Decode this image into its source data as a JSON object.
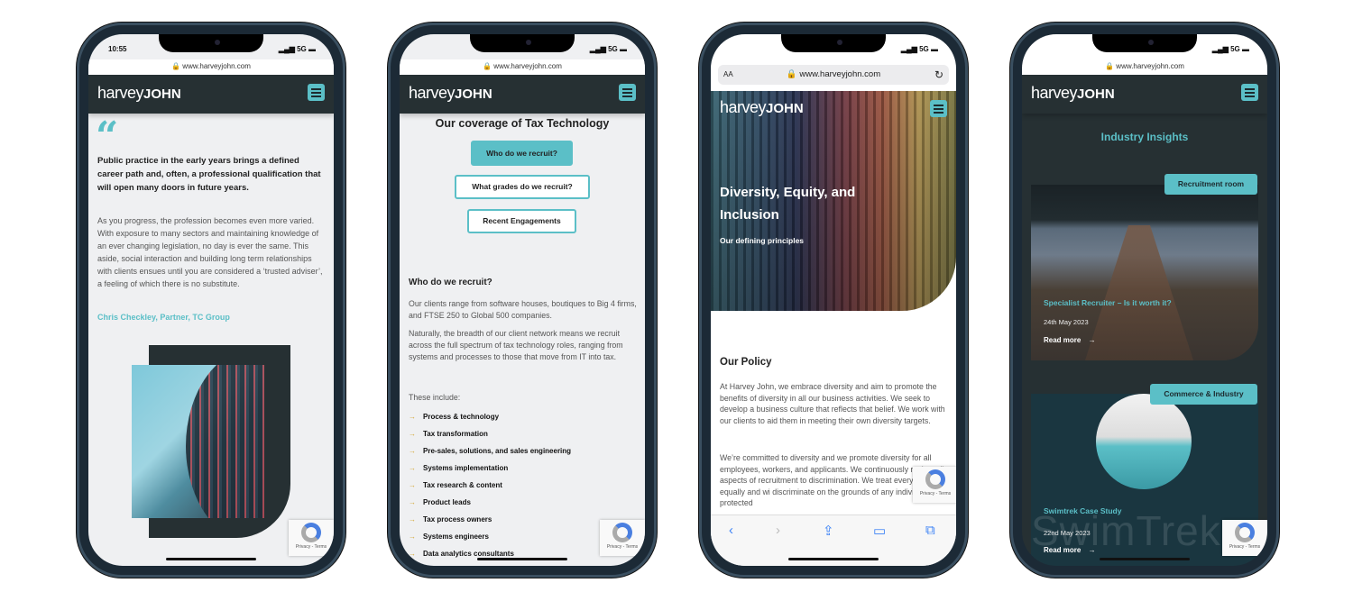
{
  "colors": {
    "accent": "#5bbfc7",
    "header": "#263033",
    "page_bg": "#eff0f2",
    "bullet": "#d4a93a"
  },
  "common": {
    "url": "www.harveyjohn.com",
    "logo_light": "harvey",
    "logo_bold": "JOHN",
    "network": "5G",
    "recaptcha": "Privacy - Terms",
    "lock_icon": "lock-icon",
    "menu_icon": "hamburger-icon"
  },
  "phone1": {
    "time": "10:55",
    "quote_mark": "“",
    "quote": "Public practice in the early years brings a defined career path and, often, a professional qualification that will open many doors in future years.",
    "body": "As you progress, the profession becomes even more varied. With exposure to many sectors and maintaining knowledge of an ever changing legislation, no day is ever the same. This aside, social interaction and building long term relationships with clients ensues until you are considered a ‘trusted adviser’, a feeling of which there is no substitute.",
    "author": "Chris Checkley, Partner, TC Group"
  },
  "phone2": {
    "title": "Our coverage of Tax Technology",
    "tabs": [
      {
        "label": "Who do we recruit?",
        "active": true
      },
      {
        "label": "What grades do we recruit?",
        "active": false
      },
      {
        "label": "Recent Engagements",
        "active": false
      }
    ],
    "section_title": "Who do we recruit?",
    "p1": "Our clients range from software houses, boutiques to Big 4 firms, and FTSE 250 to Global 500 companies.",
    "p2": "Naturally, the breadth of our client network means we recruit across the full spectrum of tax technology roles, ranging from systems and processes to those that move from IT into tax.",
    "p3": "These include:",
    "items": [
      "Process & technology",
      "Tax transformation",
      "Pre-sales, solutions, and sales engineering",
      "Systems implementation",
      "Tax research & content",
      "Product leads",
      "Tax process owners",
      "Systems engineers",
      "Data analytics consultants"
    ]
  },
  "phone3": {
    "aa": "AA",
    "hero_title": "Diversity, Equity, and Inclusion",
    "hero_subtitle": "Our defining principles",
    "policy_title": "Our Policy",
    "p1": "At Harvey John, we embrace diversity and aim to promote the benefits of diversity in all our business activities. We seek to develop a business culture that reflects that belief. We work with our clients to aid them in meeting their own diversity targets.",
    "p2": "We’re committed to diversity and we promote diversity for all employees, workers, and applicants. We continuously review all aspects of recruitment to discrimination. We treat everyone equally and wi discriminate on the grounds of any individual’s protected"
  },
  "phone4": {
    "title": "Industry Insights",
    "cards": [
      {
        "tag": "Recruitment room",
        "title": "Specialist Recruiter – Is it worth it?",
        "date": "24th May 2023",
        "link": "Read more"
      },
      {
        "tag": "Commerce & Industry",
        "title": "Swimtrek Case Study",
        "date": "22nd May 2023",
        "link": "Read more",
        "watermark": "SwimTrek"
      }
    ]
  }
}
